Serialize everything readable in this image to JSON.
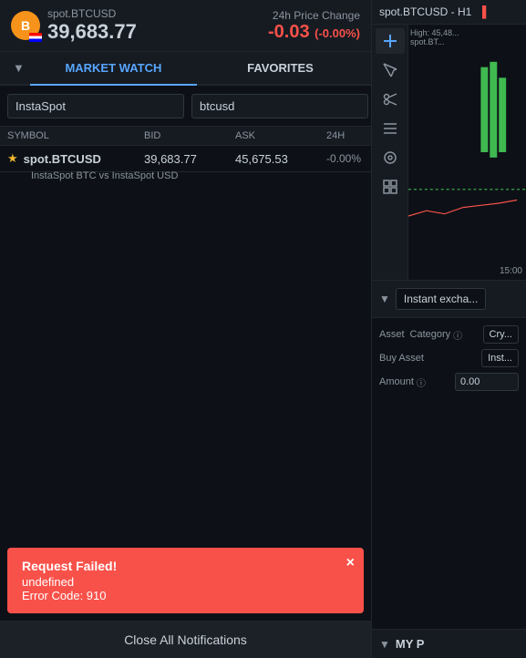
{
  "header": {
    "coin_symbol": "B",
    "symbol": "spot.BTCUSD",
    "price": "39,683.77",
    "change_label": "24h Price Change",
    "change_value": "-0.03",
    "change_pct": "(-0.00%)"
  },
  "nav": {
    "dropdown_label": "▼",
    "tab_market_watch": "MARKET WATCH",
    "tab_favorites": "FAVORITES"
  },
  "search": {
    "input1_value": "InstaSpot",
    "input1_placeholder": "InstaSpot",
    "input2_value": "btcusd",
    "input2_placeholder": "btcusd",
    "edit_icon": "✎"
  },
  "table": {
    "headers": [
      "SYMBOL",
      "BID",
      "ASK",
      "24H"
    ],
    "rows": [
      {
        "star": true,
        "symbol": "spot.BTCUSD",
        "bid": "39,683.77",
        "ask": "45,675.53",
        "change": "-0.00%",
        "subtitle": "InstaSpot BTC vs InstaSpot USD"
      }
    ]
  },
  "error": {
    "title": "Request Failed!",
    "subtitle": "undefined",
    "code": "Error Code: 910",
    "close_icon": "×"
  },
  "close_all_btn": "Close All Notifications",
  "chart": {
    "title": "spot.BTCUSD - H1",
    "price_label": "High: 45,48...",
    "spot_label": "spot.BT...",
    "time_label": "15:00"
  },
  "right_panel": {
    "instant_exchange_label": "Instant excha...",
    "asset_category_label": "Asset\nCategory",
    "asset_category_info": "ⓘ",
    "asset_category_value": "Cry...",
    "buy_asset_label": "Buy Asset",
    "buy_asset_value": "Inst...",
    "amount_label": "Amount",
    "amount_info": "ⓘ",
    "amount_value": "0.00",
    "my_p_label": "MY P"
  },
  "toolbar_icons": [
    {
      "name": "plus",
      "symbol": "+",
      "active": true
    },
    {
      "name": "cursor",
      "symbol": "↖",
      "active": false
    },
    {
      "name": "crosshair",
      "symbol": "✂",
      "active": false
    },
    {
      "name": "lines",
      "symbol": "≡",
      "active": false
    },
    {
      "name": "circles",
      "symbol": "⊙",
      "active": false
    },
    {
      "name": "grid",
      "symbol": "⊞",
      "active": false
    }
  ],
  "colors": {
    "accent_blue": "#58a6ff",
    "negative_red": "#f85149",
    "positive_green": "#3fb950",
    "background": "#0d1117",
    "surface": "#161b22",
    "border": "#21262d",
    "text_primary": "#c9d1d9",
    "text_secondary": "#8b949e"
  }
}
